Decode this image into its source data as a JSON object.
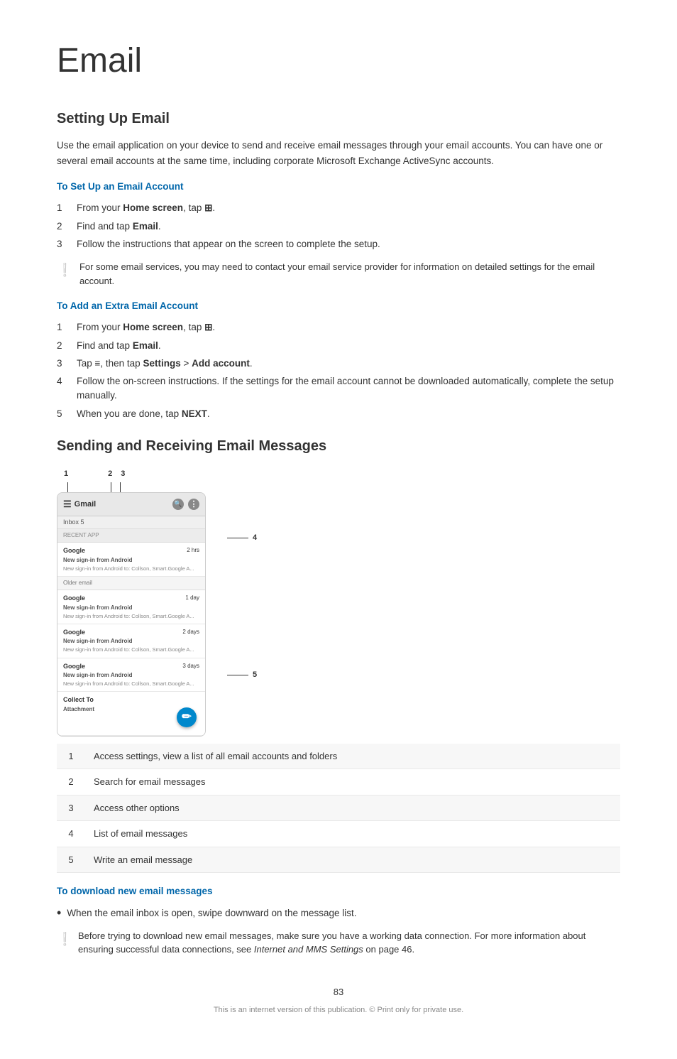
{
  "page": {
    "title": "Email",
    "page_number": "83",
    "footer_text": "This is an internet version of this publication. © Print only for private use."
  },
  "setting_up_email": {
    "section_title": "Setting Up Email",
    "intro_text": "Use the email application on your device to send and receive email messages through your email accounts. You can have one or several email accounts at the same time, including corporate Microsoft Exchange ActiveSync accounts.",
    "subsection1": {
      "title": "To Set Up an Email Account",
      "steps": [
        {
          "num": "1",
          "text": "From your <b>Home screen</b>, tap <b>⊞</b>."
        },
        {
          "num": "2",
          "text": "Find and tap <b>Email</b>."
        },
        {
          "num": "3",
          "text": "Follow the instructions that appear on the screen to complete the setup."
        }
      ],
      "note": "For some email services, you may need to contact your email service provider for information on detailed settings for the email account."
    },
    "subsection2": {
      "title": "To Add an Extra Email Account",
      "steps": [
        {
          "num": "1",
          "text": "From your <b>Home screen</b>, tap <b>⊞</b>."
        },
        {
          "num": "2",
          "text": "Find and tap <b>Email</b>."
        },
        {
          "num": "3",
          "text": "Tap ≡, then tap <b>Settings</b> > <b>Add account</b>."
        },
        {
          "num": "4",
          "text": "Follow the on-screen instructions. If the settings for the email account cannot be downloaded automatically, complete the setup manually."
        },
        {
          "num": "5",
          "text": "When you are done, tap <b>NEXT</b>."
        }
      ]
    }
  },
  "sending_receiving": {
    "section_title": "Sending and Receiving Email Messages",
    "phone_screen": {
      "header_label": "Gmail",
      "inbox_label": "Inbox 5",
      "section_recent": "RECENT APP",
      "emails": [
        {
          "sender": "Google",
          "time": "2 hrs",
          "subject": "New sign-in from Android",
          "preview": "New sign-in from Android to: Collson, Smart.Google A..."
        },
        {
          "sender": "Google",
          "time": "1 day",
          "subject": "New sign-in from Android",
          "preview": "New sign-in from Android to: Collson, Smart.Google A..."
        },
        {
          "sender": "Google",
          "time": "2 days",
          "subject": "New sign-in from Android",
          "preview": "New sign-in from Android to: Collson, Smart.Google A..."
        },
        {
          "sender": "Google",
          "time": "3 days",
          "subject": "New sign-in from Android",
          "preview": "New sign-in from Android to: Collson, Smart.Google A..."
        }
      ],
      "older_section": "Older email",
      "older_email": {
        "sender": "Collect To",
        "subject": "Attachment"
      }
    },
    "diagram_labels": [
      {
        "num": "1",
        "position": "top-left"
      },
      {
        "num": "2",
        "position": "top-center"
      },
      {
        "num": "3",
        "position": "top-right"
      },
      {
        "num": "4",
        "position": "right-middle"
      },
      {
        "num": "5",
        "position": "right-bottom"
      }
    ],
    "legend": [
      {
        "num": "1",
        "desc": "Access settings, view a list of all email accounts and folders"
      },
      {
        "num": "2",
        "desc": "Search for email messages"
      },
      {
        "num": "3",
        "desc": "Access other options"
      },
      {
        "num": "4",
        "desc": "List of email messages"
      },
      {
        "num": "5",
        "desc": "Write an email message"
      }
    ],
    "subsection_download": {
      "title": "To download new email messages",
      "bullet": "When the email inbox is open, swipe downward on the message list.",
      "note": "Before trying to download new email messages, make sure you have a working data connection. For more information about ensuring successful data connections, see Internet and MMS Settings on page 46."
    }
  }
}
